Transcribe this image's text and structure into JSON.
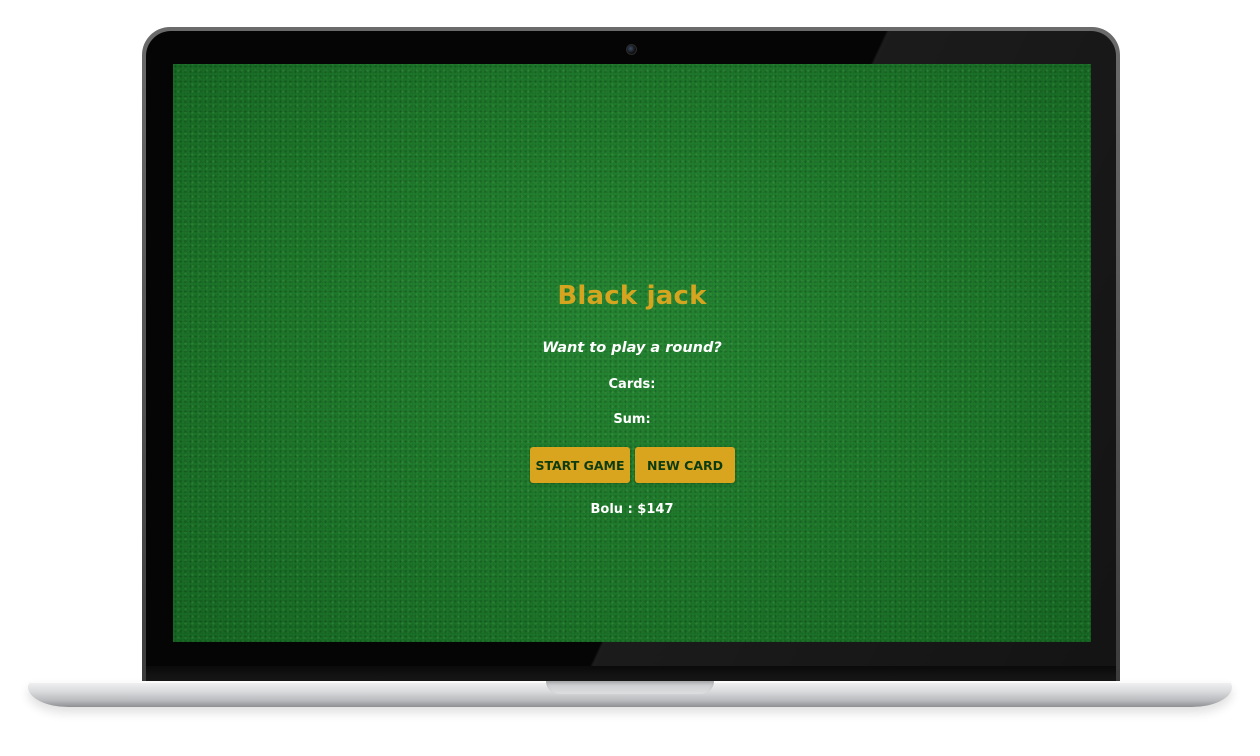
{
  "game": {
    "title": "Black jack",
    "message": "Want to play a round?",
    "cards_label": "Cards:",
    "sum_label": "Sum:",
    "buttons": {
      "start_label": "START GAME",
      "new_card_label": "NEW CARD"
    },
    "player": {
      "name": "Bolu",
      "chips": "$147",
      "display": "Bolu : $147"
    }
  },
  "colors": {
    "felt": "#1f7a2c",
    "accent_gold": "#d6a520",
    "button_text": "#0c3b10",
    "text": "#ffffff"
  }
}
